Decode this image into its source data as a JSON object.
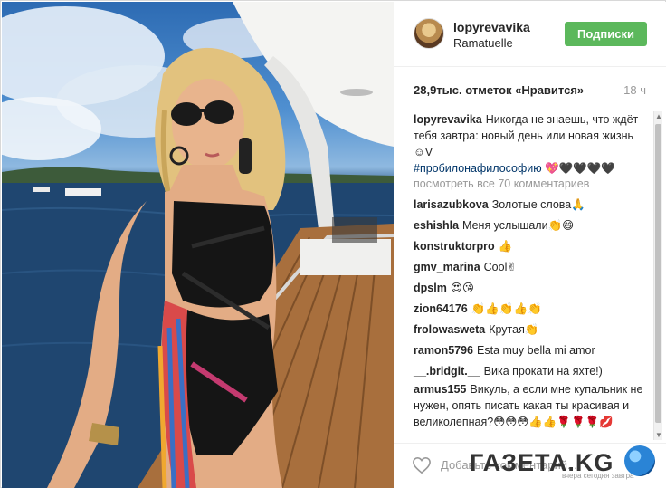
{
  "post": {
    "username": "lopyrevavika",
    "location": "Ramatuelle",
    "follow_label": "Подписки",
    "likes": "28,9тыс. отметок «Нравится»",
    "time": "18 ч"
  },
  "caption": {
    "username": "lopyrevavika",
    "text": "Никогда не знаешь, что ждёт тебя завтра: новый день или новая жизнь ☺V",
    "hashtag": "#пробилонафилософию",
    "emoji": "💖🖤🖤🖤🖤"
  },
  "view_all": "посмотреть все 70 комментариев",
  "comments": [
    {
      "user": "larisazubkova",
      "text": "Золотые слова🙏"
    },
    {
      "user": "eshishla",
      "text": "Меня услышали👏😄"
    },
    {
      "user": "konstruktorpro",
      "text": "👍"
    },
    {
      "user": "gmv_marina",
      "text": "Cool✌"
    },
    {
      "user": "dpslm",
      "text": "😍😘"
    },
    {
      "user": "zion64176",
      "text": "👏👍👏👍👏"
    },
    {
      "user": "frolowasweta",
      "text": "Крутая👏"
    },
    {
      "user": "ramon5796",
      "text": "Esta muy bella mi amor"
    },
    {
      "user": "__.bridgit.__",
      "text": "Вика прокати на яхте!)"
    },
    {
      "user": "armus155",
      "text": "Викуль, а если мне купальник не нужен, опять писать какая ты красивая и великолепная?😳😳😳👍👍🌹🌹🌹💋"
    }
  ],
  "footer": {
    "add_comment": "Добавьте комментарий...",
    "watermark": "ГАЗЕТА.KG",
    "watermark_tagline": "вчера сегодня завтра"
  }
}
